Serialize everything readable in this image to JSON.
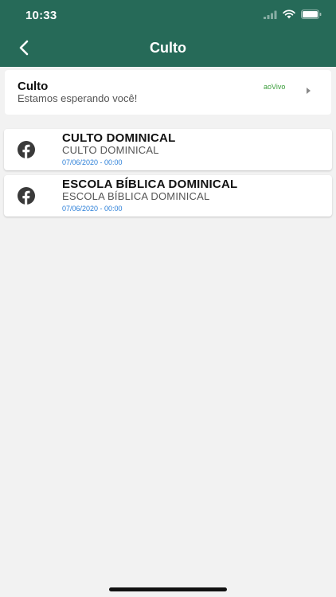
{
  "status_bar": {
    "time": "10:33",
    "icons": [
      "signal-icon",
      "wifi-icon",
      "battery-icon"
    ]
  },
  "nav": {
    "title": "Culto",
    "back_icon": "chevron-left-icon"
  },
  "live_card": {
    "title": "Culto",
    "subtitle": "Estamos esperando você!",
    "badge": "aoVivo",
    "badge_color": "#3a9d3a",
    "arrow_icon": "play-right-icon"
  },
  "events": [
    {
      "icon": "facebook-icon",
      "title": "CULTO DOMINICAL",
      "subtitle": "CULTO DOMINICAL",
      "date": "07/06/2020 - 00:00"
    },
    {
      "icon": "facebook-icon",
      "title": "ESCOLA BÍBLICA DOMINICAL",
      "subtitle": "ESCOLA BÍBLICA DOMINICAL",
      "date": "07/06/2020 - 00:00"
    }
  ],
  "colors": {
    "header_bg": "#266a58",
    "page_bg": "#f2f2f2",
    "date_color": "#2b7fd8",
    "icon_color": "#3a3a3a"
  }
}
